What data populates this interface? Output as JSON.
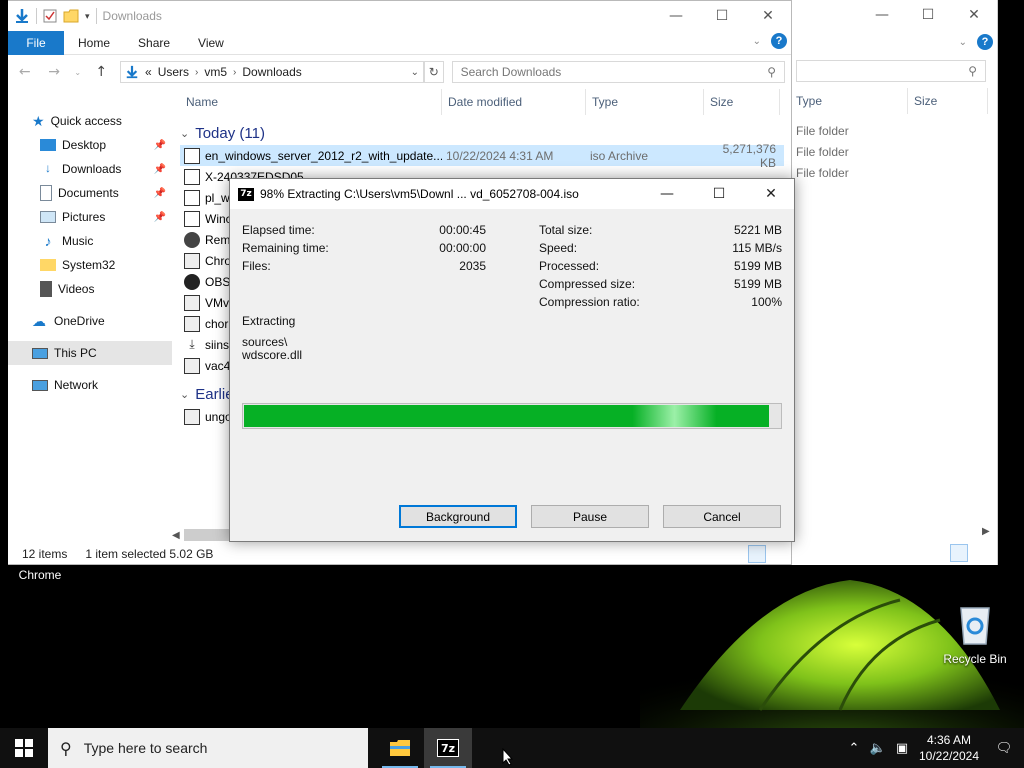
{
  "desktop": {
    "chrome_label": "Chrome",
    "recycle_bin_label": "Recycle Bin"
  },
  "explorer": {
    "title": "Downloads",
    "ribbon_tabs": [
      "File",
      "Home",
      "Share",
      "View"
    ],
    "address": {
      "prefix": "«",
      "crumbs": [
        "Users",
        "vm5",
        "Downloads"
      ]
    },
    "search_placeholder": "Search Downloads",
    "nav": {
      "quick_access": "Quick access",
      "desktop": "Desktop",
      "downloads": "Downloads",
      "documents": "Documents",
      "pictures": "Pictures",
      "music": "Music",
      "system32": "System32",
      "videos": "Videos",
      "onedrive": "OneDrive",
      "this_pc": "This PC",
      "network": "Network"
    },
    "columns": {
      "name": "Name",
      "date": "Date modified",
      "type": "Type",
      "size": "Size"
    },
    "group_today": "Today (11)",
    "group_earlier": "Earlier",
    "files": [
      {
        "name": "en_windows_server_2012_r2_with_update...",
        "date": "10/22/2024 4:31 AM",
        "type": "iso Archive",
        "size": "5,271,376 KB"
      },
      {
        "name": "X-240337EDSD05",
        "date": "",
        "type": "",
        "size": ""
      },
      {
        "name": "pl_w",
        "date": "",
        "type": "",
        "size": ""
      },
      {
        "name": "Winc",
        "date": "",
        "type": "",
        "size": ""
      },
      {
        "name": "Rem",
        "date": "",
        "type": "",
        "size": ""
      },
      {
        "name": "Chro",
        "date": "",
        "type": "",
        "size": ""
      },
      {
        "name": "OBS",
        "date": "",
        "type": "",
        "size": ""
      },
      {
        "name": "VMv",
        "date": "",
        "type": "",
        "size": ""
      },
      {
        "name": "chor",
        "date": "",
        "type": "",
        "size": ""
      },
      {
        "name": "siins",
        "date": "",
        "type": "",
        "size": ""
      },
      {
        "name": "vac4",
        "date": "",
        "type": "",
        "size": ""
      }
    ],
    "earlier_files": [
      {
        "name": "ungo"
      }
    ],
    "status": {
      "items": "12 items",
      "selected": "1 item selected  5.02 GB"
    }
  },
  "explorer_back": {
    "columns": {
      "type": "Type",
      "size": "Size"
    },
    "rows": [
      "File folder",
      "File folder",
      "File folder"
    ]
  },
  "zip_dialog": {
    "title": "98% Extracting C:\\Users\\vm5\\Downl ... vd_6052708-004.iso",
    "left_stats": [
      {
        "label": "Elapsed time:",
        "value": "00:00:45"
      },
      {
        "label": "Remaining time:",
        "value": "00:00:00"
      },
      {
        "label": "Files:",
        "value": "2035"
      }
    ],
    "right_stats": [
      {
        "label": "Total size:",
        "value": "5221 MB"
      },
      {
        "label": "Speed:",
        "value": "115 MB/s"
      },
      {
        "label": "Processed:",
        "value": "5199 MB"
      },
      {
        "label": "Compressed size:",
        "value": "5199 MB"
      },
      {
        "label": "Compression ratio:",
        "value": "100%"
      }
    ],
    "extracting_label": "Extracting",
    "current_path": "sources\\",
    "current_file": "wdscore.dll",
    "progress_percent": 98,
    "buttons": {
      "background": "Background",
      "pause": "Pause",
      "cancel": "Cancel"
    }
  },
  "taskbar": {
    "search_placeholder": "Type here to search",
    "time": "4:36 AM",
    "date": "10/22/2024"
  },
  "colors": {
    "accent": "#1979ca",
    "progress_green": "#06b025",
    "selection": "#cce8ff"
  }
}
